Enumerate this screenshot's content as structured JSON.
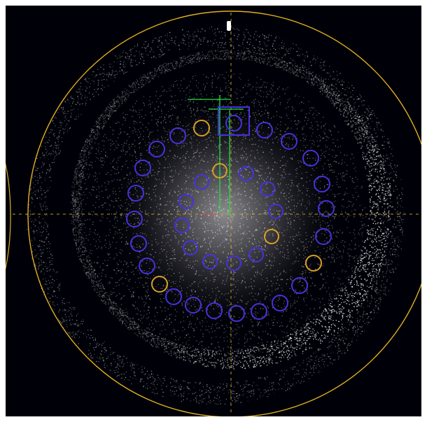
{
  "colors": {
    "background": "#000008",
    "reference_circle": "#e0b020",
    "crosshair": "#d4b020",
    "spot_marker_blue": "#4433dd",
    "spot_marker_yellow": "#d9a020",
    "beam_axis": "#20e040",
    "readout_text": "#ff2a2a",
    "status_text": "#3a52ff",
    "diffraction_ring": "#ffffff"
  },
  "icons": {
    "beam_stop": "beam-stop-icon",
    "beam_center": "beam-center-icon"
  },
  "readouts": {
    "left": [
      "",
      "",
      "",
      "",
      "",
      "",
      "",
      "",
      "",
      "",
      "",
      "",
      "",
      "",
      "",
      "",
      "",
      "",
      "",
      "",
      "",
      "",
      "",
      "",
      "",
      "",
      "",
      "",
      "",
      "",
      "",
      "",
      "",
      "",
      "",
      "",
      "",
      "",
      ""
    ],
    "right": [
      "",
      "",
      "",
      "",
      "",
      "",
      "",
      "",
      "",
      "",
      "",
      "",
      "",
      "",
      "",
      "",
      "",
      "",
      "",
      "",
      "",
      "",
      "",
      "",
      "",
      "",
      "",
      "",
      "",
      ""
    ],
    "top": "",
    "bottom": [
      "",
      ""
    ]
  }
}
